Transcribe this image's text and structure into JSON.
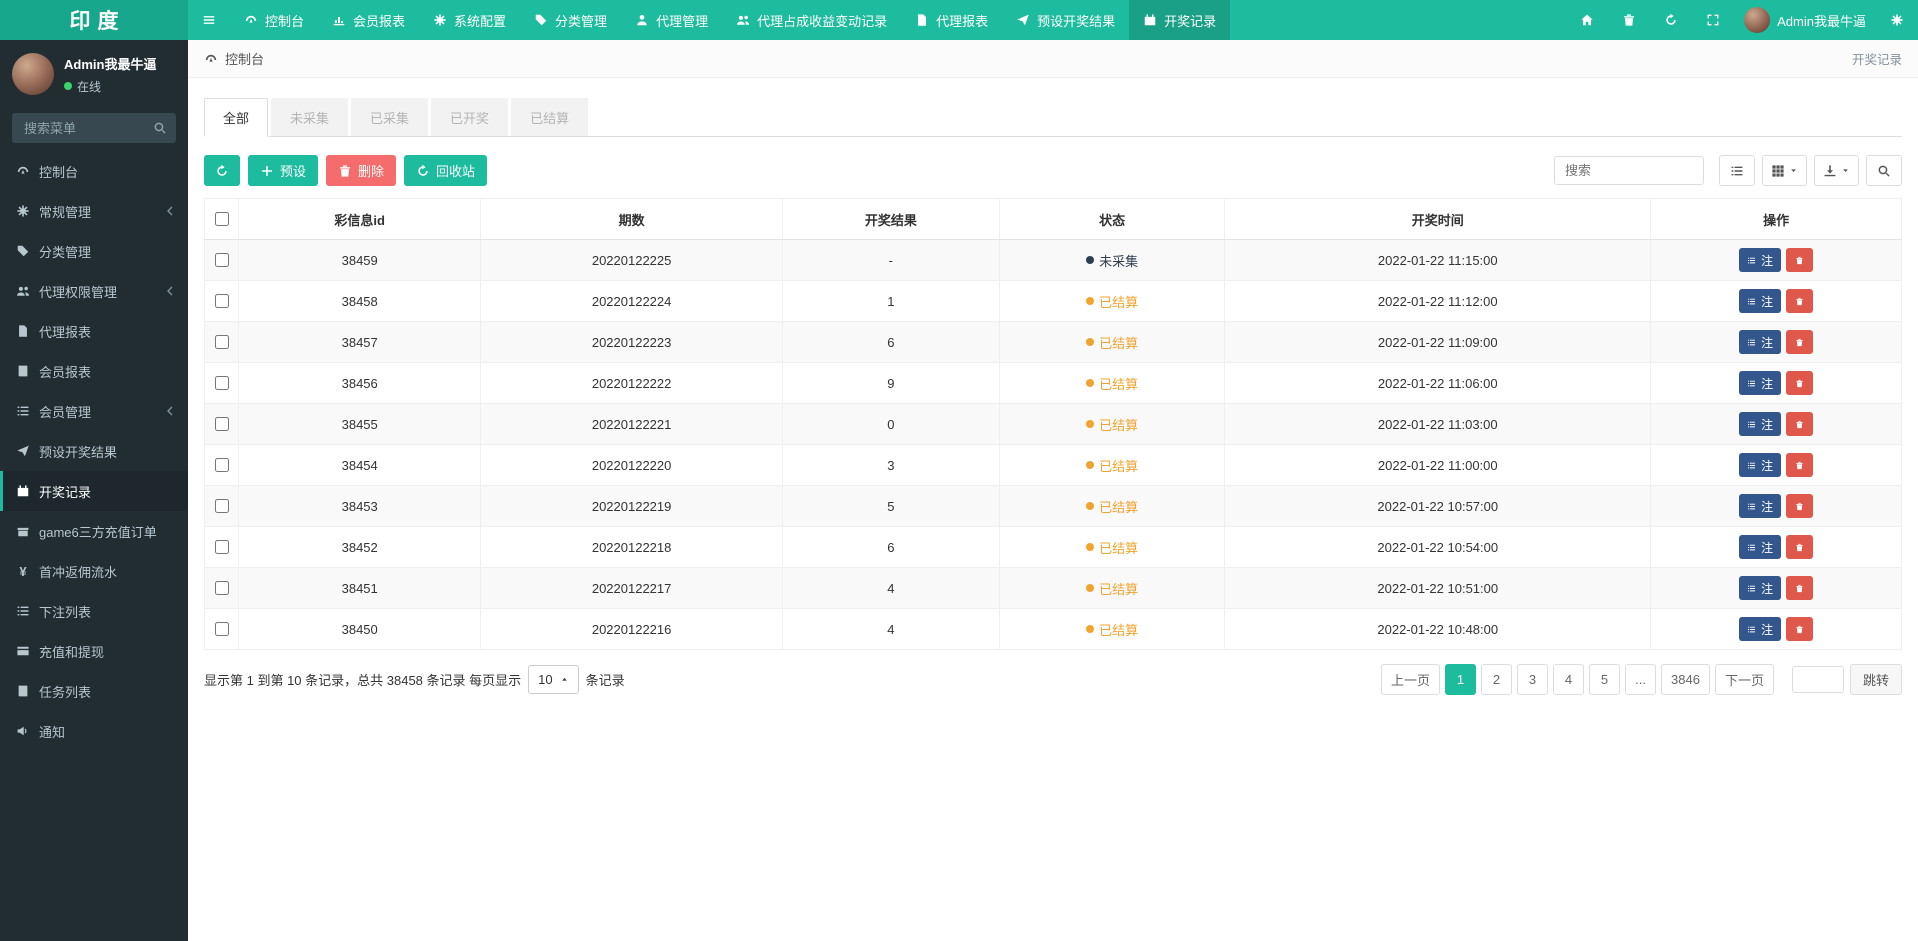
{
  "colors": {
    "primary": "#1ebc9e",
    "primary_dark": "#17a78c",
    "danger_button": "#f56c6c",
    "note_button": "#33568c",
    "delete_button": "#e0584c",
    "status_settled": "#f0a32e",
    "status_uncollected": "#2c3e50",
    "online": "#3ad46c"
  },
  "topbar": {
    "logo": "印度",
    "items": [
      {
        "label": "控制台",
        "icon": "gauge"
      },
      {
        "label": "会员报表",
        "icon": "chart"
      },
      {
        "label": "系统配置",
        "icon": "gear"
      },
      {
        "label": "分类管理",
        "icon": "tag"
      },
      {
        "label": "代理管理",
        "icon": "user"
      },
      {
        "label": "代理占成收益变动记录",
        "icon": "users"
      },
      {
        "label": "代理报表",
        "icon": "file"
      },
      {
        "label": "预设开奖结果",
        "icon": "send"
      },
      {
        "label": "开奖记录",
        "icon": "calendar",
        "active": true
      }
    ],
    "user_name": "Admin我最牛逼"
  },
  "sidebar": {
    "user_name": "Admin我最牛逼",
    "user_status": "在线",
    "search_placeholder": "搜索菜单",
    "items": [
      {
        "label": "控制台",
        "icon": "gauge"
      },
      {
        "label": "常规管理",
        "icon": "gear",
        "chevron": true
      },
      {
        "label": "分类管理",
        "icon": "tag"
      },
      {
        "label": "代理权限管理",
        "icon": "users",
        "chevron": true
      },
      {
        "label": "代理报表",
        "icon": "file"
      },
      {
        "label": "会员报表",
        "icon": "book"
      },
      {
        "label": "会员管理",
        "icon": "list",
        "chevron": true
      },
      {
        "label": "预设开奖结果",
        "icon": "send"
      },
      {
        "label": "开奖记录",
        "icon": "calendar",
        "active": true
      },
      {
        "label": "game6三方充值订单",
        "icon": "gift"
      },
      {
        "label": "首冲返佣流水",
        "icon": "yen"
      },
      {
        "label": "下注列表",
        "icon": "list"
      },
      {
        "label": "充值和提现",
        "icon": "card"
      },
      {
        "label": "任务列表",
        "icon": "book"
      },
      {
        "label": "通知",
        "icon": "horn"
      }
    ]
  },
  "breadcrumb": {
    "location": "控制台",
    "current": "开奖记录"
  },
  "tabs": [
    {
      "label": "全部",
      "active": true
    },
    {
      "label": "未采集"
    },
    {
      "label": "已采集"
    },
    {
      "label": "已开奖"
    },
    {
      "label": "已结算"
    }
  ],
  "toolbar": {
    "preset_label": "预设",
    "delete_label": "删除",
    "recycle_label": "回收站",
    "search_placeholder": "搜索"
  },
  "table": {
    "headers": [
      "彩信息id",
      "期数",
      "开奖结果",
      "状态",
      "开奖时间",
      "操作"
    ],
    "col_widths": [
      "14.5%",
      "18%",
      "13%",
      "13.5%",
      "25.5%",
      "15%"
    ],
    "note_button_label": "注",
    "rows": [
      {
        "id": "38459",
        "period": "20220122225",
        "result": "-",
        "status": "未采集",
        "status_type": "uncollected",
        "time": "2022-01-22 11:15:00"
      },
      {
        "id": "38458",
        "period": "20220122224",
        "result": "1",
        "status": "已结算",
        "status_type": "settled",
        "time": "2022-01-22 11:12:00"
      },
      {
        "id": "38457",
        "period": "20220122223",
        "result": "6",
        "status": "已结算",
        "status_type": "settled",
        "time": "2022-01-22 11:09:00"
      },
      {
        "id": "38456",
        "period": "20220122222",
        "result": "9",
        "status": "已结算",
        "status_type": "settled",
        "time": "2022-01-22 11:06:00"
      },
      {
        "id": "38455",
        "period": "20220122221",
        "result": "0",
        "status": "已结算",
        "status_type": "settled",
        "time": "2022-01-22 11:03:00"
      },
      {
        "id": "38454",
        "period": "20220122220",
        "result": "3",
        "status": "已结算",
        "status_type": "settled",
        "time": "2022-01-22 11:00:00"
      },
      {
        "id": "38453",
        "period": "20220122219",
        "result": "5",
        "status": "已结算",
        "status_type": "settled",
        "time": "2022-01-22 10:57:00"
      },
      {
        "id": "38452",
        "period": "20220122218",
        "result": "6",
        "status": "已结算",
        "status_type": "settled",
        "time": "2022-01-22 10:54:00"
      },
      {
        "id": "38451",
        "period": "20220122217",
        "result": "4",
        "status": "已结算",
        "status_type": "settled",
        "time": "2022-01-22 10:51:00"
      },
      {
        "id": "38450",
        "period": "20220122216",
        "result": "4",
        "status": "已结算",
        "status_type": "settled",
        "time": "2022-01-22 10:48:00"
      }
    ]
  },
  "footer": {
    "summary_prefix": "显示第 1 到第 10 条记录，总共 38458 条记录 每页显示",
    "per_page": "10",
    "summary_suffix": "条记录",
    "pages": [
      {
        "label": "上一页"
      },
      {
        "label": "1",
        "active": true
      },
      {
        "label": "2"
      },
      {
        "label": "3"
      },
      {
        "label": "4"
      },
      {
        "label": "5"
      },
      {
        "label": "..."
      },
      {
        "label": "3846"
      },
      {
        "label": "下一页"
      }
    ],
    "jump_label": "跳转"
  }
}
